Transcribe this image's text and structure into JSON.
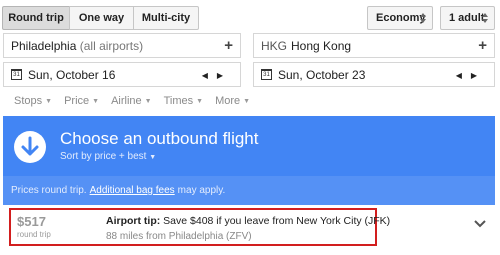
{
  "trip_tabs": {
    "round_trip": "Round trip",
    "one_way": "One way",
    "multi_city": "Multi-city"
  },
  "cabin_select": "Economy",
  "passenger_select": "1 adult",
  "origin": {
    "city": "Philadelphia",
    "detail": "(all airports)"
  },
  "destination": {
    "code": "HKG",
    "city": "Hong Kong"
  },
  "departure_date": "Sun, October 16",
  "return_date": "Sun, October 23",
  "calendar_glyph": "31",
  "filters": [
    "Stops",
    "Price",
    "Airline",
    "Times",
    "More"
  ],
  "banner": {
    "title": "Choose an outbound flight",
    "sort": "Sort by price + best",
    "note_prefix": "Prices round trip.",
    "note_link": "Additional bag fees",
    "note_suffix": "may apply."
  },
  "result": {
    "price": "$517",
    "price_type": "round trip",
    "tip_label": "Airport tip:",
    "tip_text": "Save $408 if you leave from New York City (JFK)",
    "distance": "88 miles from Philadelphia (ZFV)"
  },
  "colors": {
    "banner": "#4285f4",
    "banner_footer": "#5591f5",
    "highlight": "#d21e1e"
  }
}
